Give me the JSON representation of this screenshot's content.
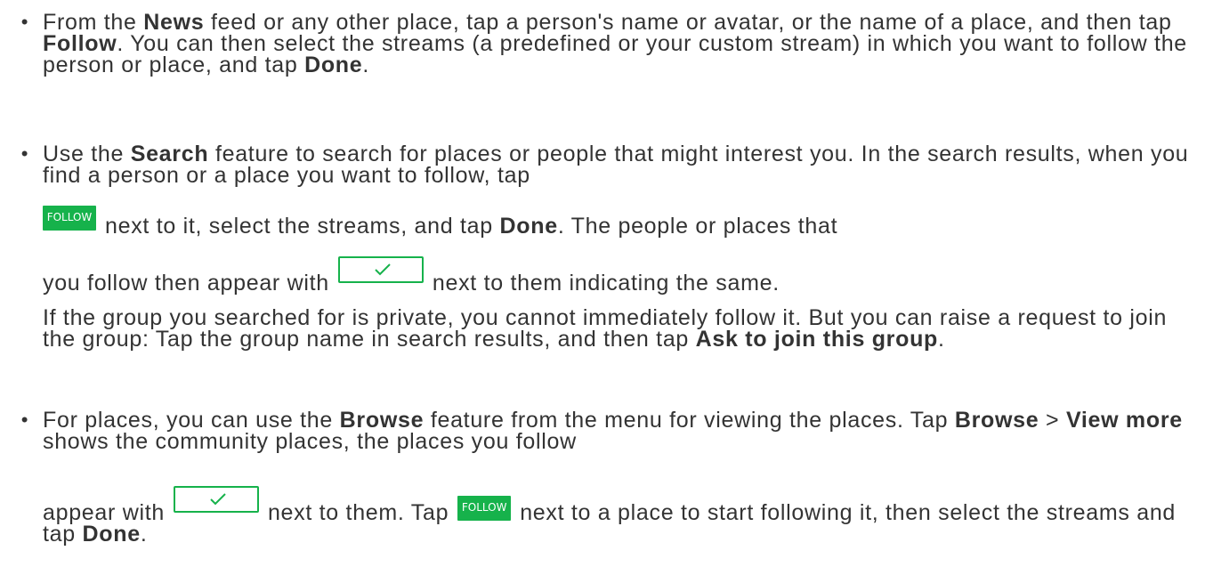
{
  "bullet_glyph": "•",
  "item1": {
    "t1": "From the ",
    "b1": "News",
    "t2": " feed or any other place, tap a person's name or avatar, or the name of a place, and then tap ",
    "b2": "Follow",
    "t3": ". You can then select the streams (a predefined or your custom stream) in which you want to follow the person or place, and tap ",
    "b3": "Done",
    "t4": "."
  },
  "item2": {
    "t1": "Use the ",
    "b1": "Search",
    "t2": " feature to search for places or people that might interest you. In the search results, when you find a person or a place you want to follow, tap",
    "follow_label": "FOLLOW",
    "t3": "next to it, select the streams, and tap ",
    "b2": "Done",
    "t4": ". The people or places that",
    "t5": "you follow then appear with",
    "t6": "next to them indicating the same.",
    "p2_t1": "If the group you searched for is private, you cannot immediately follow it. But you can raise a request to join the group: Tap the group name in search results, and then tap ",
    "p2_b1": "Ask to join this group",
    "p2_t2": "."
  },
  "item3": {
    "t1": "For places, you can use the ",
    "b1": "Browse",
    "t2": " feature from the menu for viewing the places. Tap  ",
    "b2": "Browse",
    "t3": " > ",
    "b3": "View more",
    "t4": "  shows the community places, the places you follow",
    "t5": "appear with",
    "t6": "next to them. Tap",
    "follow_label": "FOLLOW",
    "t7": "next to a place to start following it, then select the streams and tap ",
    "b4": "Done",
    "t8": "."
  },
  "colors": {
    "text": "#333333",
    "accent_green": "#16b24b",
    "background": "#ffffff"
  },
  "icons": {
    "followed_indicator": "check-icon"
  }
}
